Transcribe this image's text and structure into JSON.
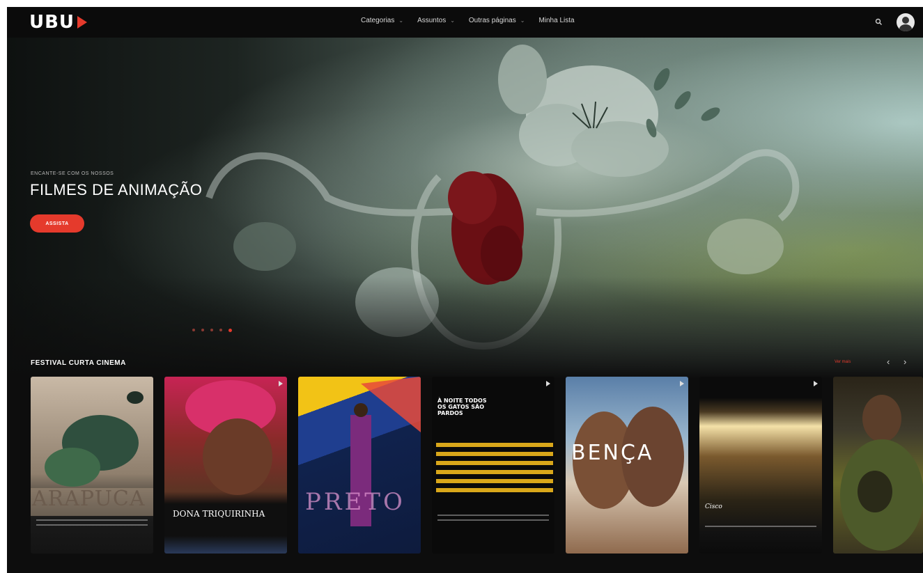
{
  "app": {
    "logo_text": "UBU",
    "brand_color": "#e53a2c"
  },
  "nav": {
    "items": [
      {
        "label": "Categorias",
        "has_dropdown": true
      },
      {
        "label": "Assuntos",
        "has_dropdown": true
      },
      {
        "label": "Outras páginas",
        "has_dropdown": true
      },
      {
        "label": "Minha Lista",
        "has_dropdown": false
      }
    ],
    "chevron": "⌄",
    "search_icon": "search-icon",
    "avatar_icon": "user-avatar-icon"
  },
  "hero": {
    "eyebrow": "ENCANTE-SE COM OS NOSSOS",
    "title": "FILMES DE ANIMAÇÃO",
    "cta_label": "ASSISTA",
    "slides_total": 5,
    "active_slide": 5
  },
  "row": {
    "title": "FESTIVAL CURTA CINEMA",
    "see_all_label": "Ver mais",
    "prev_glyph": "‹",
    "next_glyph": "›",
    "posters": [
      {
        "title": "ARAPUCA"
      },
      {
        "title": "DONA TRIQUIRINHA"
      },
      {
        "title": "PRETO"
      },
      {
        "title": "À NOITE TODOS OS GATOS SÃO PARDOS"
      },
      {
        "title": "BENÇA"
      },
      {
        "title": "Cisco"
      },
      {
        "title": ""
      }
    ]
  }
}
